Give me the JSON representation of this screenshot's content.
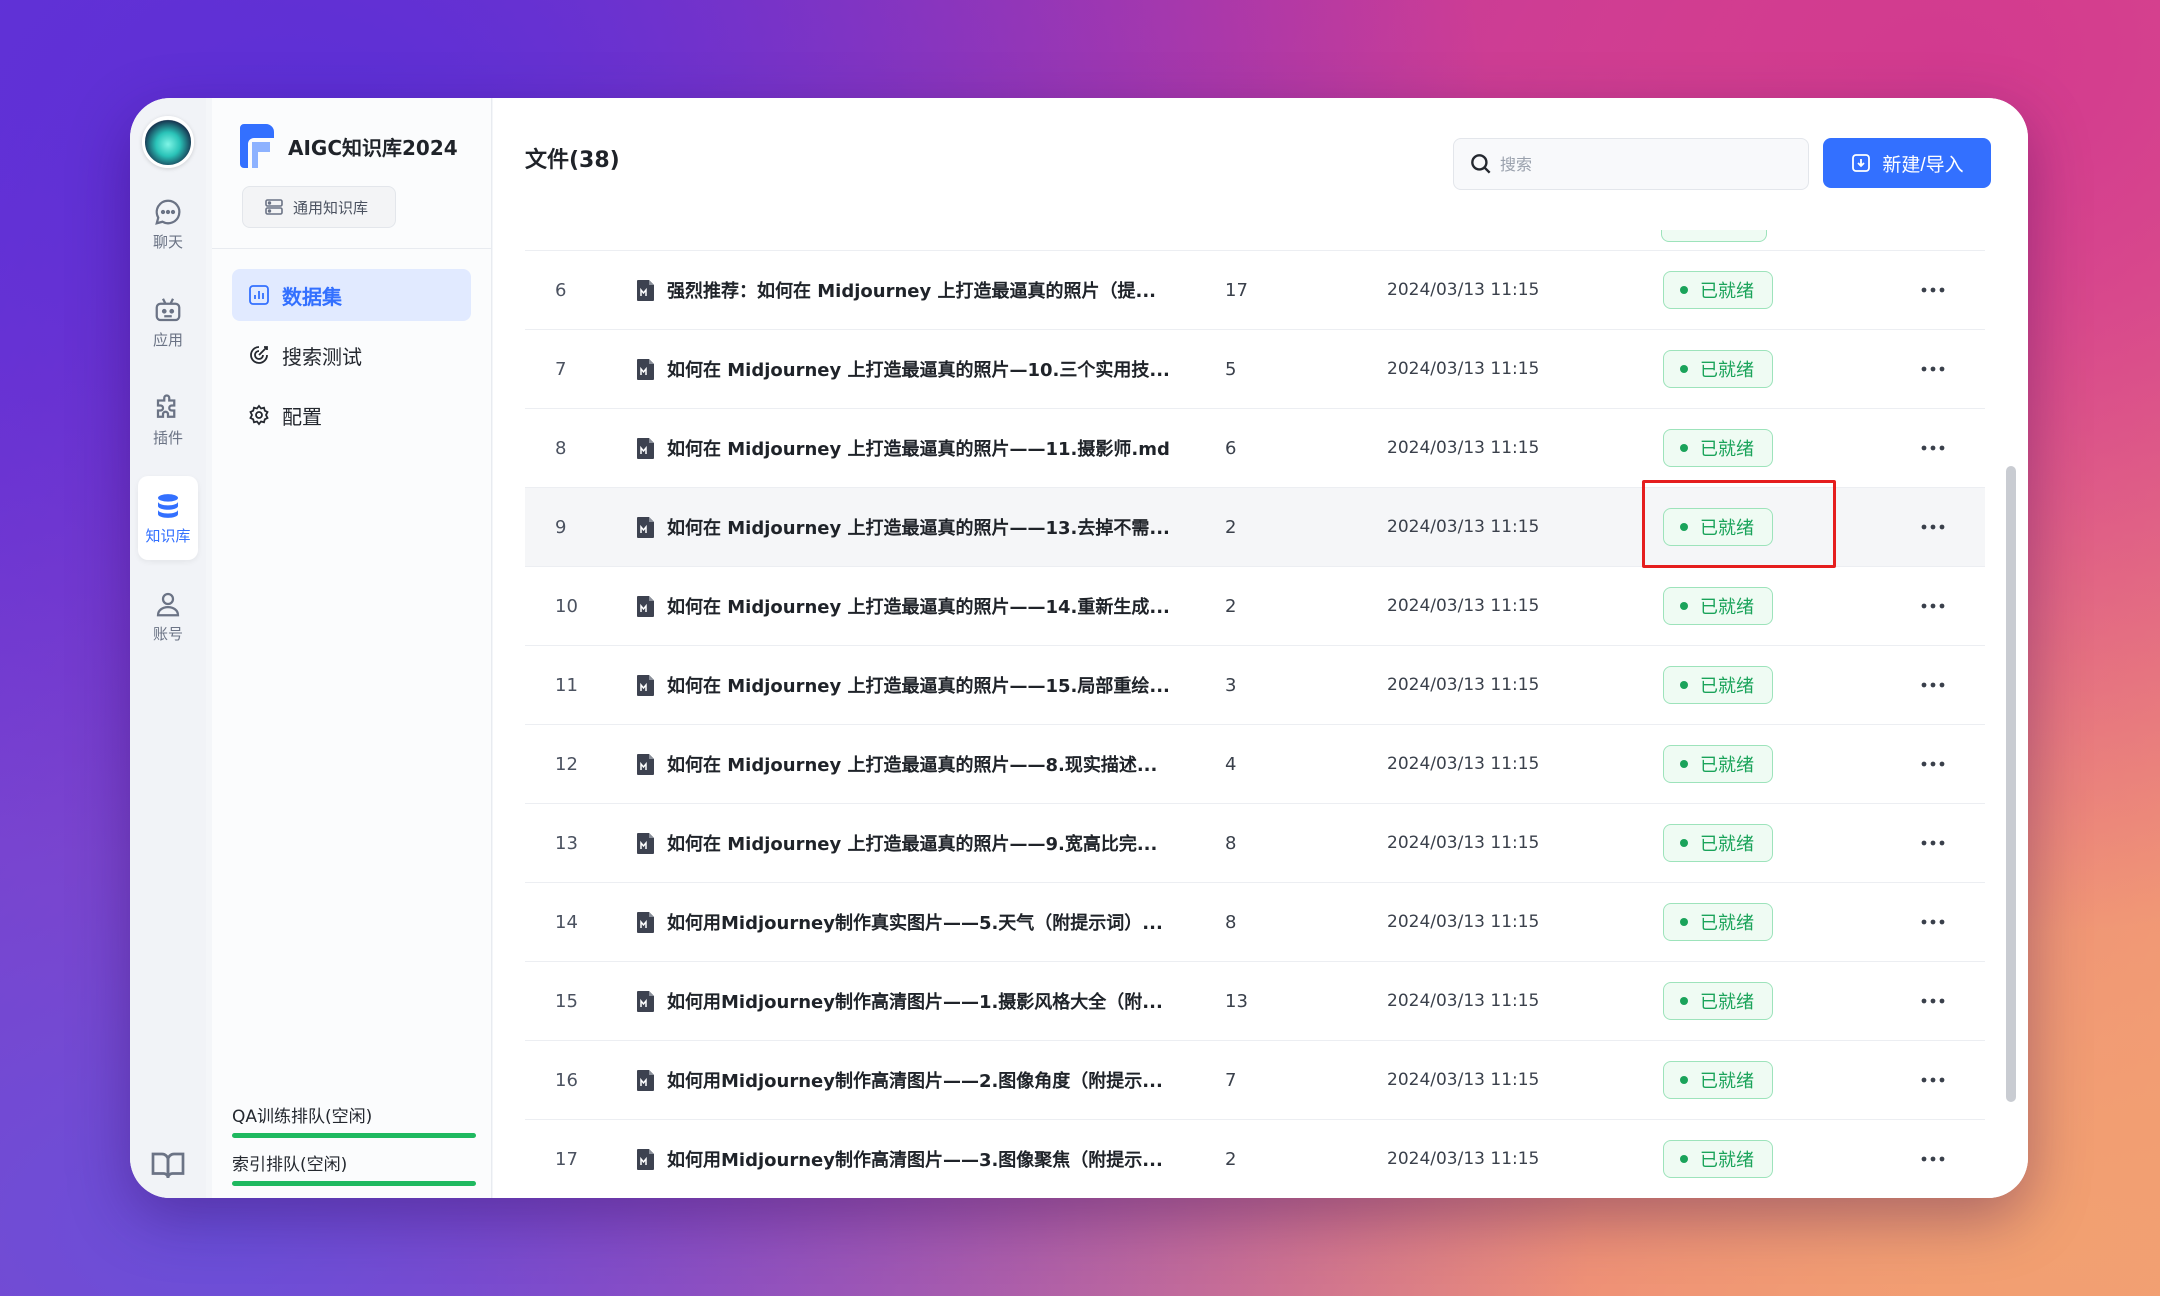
{
  "rail": {
    "items": [
      {
        "label": "聊天",
        "icon": "chat-icon"
      },
      {
        "label": "应用",
        "icon": "robot-icon"
      },
      {
        "label": "插件",
        "icon": "puzzle-icon"
      },
      {
        "label": "知识库",
        "icon": "database-icon",
        "active": true
      },
      {
        "label": "账号",
        "icon": "user-icon"
      }
    ]
  },
  "sidebar": {
    "kb_name": "AIGC知识库2024",
    "kb_type": "通用知识库",
    "nav": [
      {
        "label": "数据集",
        "active": true
      },
      {
        "label": "搜索测试"
      },
      {
        "label": "配置"
      }
    ],
    "queues": [
      {
        "label": "QA训练排队(空闲)"
      },
      {
        "label": "索引排队(空闲)"
      }
    ]
  },
  "main": {
    "title": "文件(38)",
    "search_placeholder": "搜索",
    "new_button": "新建/导入"
  },
  "files": [
    {
      "idx": "6",
      "name": "强烈推荐：如何在 Midjourney 上打造最逼真的照片（提...",
      "count": "17",
      "date": "2024/03/13 11:15",
      "status": "已就绪"
    },
    {
      "idx": "7",
      "name": "如何在 Midjourney 上打造最逼真的照片—10.三个实用技...",
      "count": "5",
      "date": "2024/03/13 11:15",
      "status": "已就绪"
    },
    {
      "idx": "8",
      "name": "如何在 Midjourney 上打造最逼真的照片——11.摄影师.md",
      "count": "6",
      "date": "2024/03/13 11:15",
      "status": "已就绪"
    },
    {
      "idx": "9",
      "name": "如何在 Midjourney 上打造最逼真的照片——13.去掉不需...",
      "count": "2",
      "date": "2024/03/13 11:15",
      "status": "已就绪"
    },
    {
      "idx": "10",
      "name": "如何在 Midjourney 上打造最逼真的照片——14.重新生成...",
      "count": "2",
      "date": "2024/03/13 11:15",
      "status": "已就绪"
    },
    {
      "idx": "11",
      "name": "如何在 Midjourney 上打造最逼真的照片——15.局部重绘...",
      "count": "3",
      "date": "2024/03/13 11:15",
      "status": "已就绪"
    },
    {
      "idx": "12",
      "name": "如何在 Midjourney 上打造最逼真的照片——8.现实描述...",
      "count": "4",
      "date": "2024/03/13 11:15",
      "status": "已就绪"
    },
    {
      "idx": "13",
      "name": "如何在 Midjourney 上打造最逼真的照片——9.宽高比完...",
      "count": "8",
      "date": "2024/03/13 11:15",
      "status": "已就绪"
    },
    {
      "idx": "14",
      "name": "如何用Midjourney制作真实图片——5.天气（附提示词）...",
      "count": "8",
      "date": "2024/03/13 11:15",
      "status": "已就绪"
    },
    {
      "idx": "15",
      "name": "如何用Midjourney制作高清图片——1.摄影风格大全（附...",
      "count": "13",
      "date": "2024/03/13 11:15",
      "status": "已就绪"
    },
    {
      "idx": "16",
      "name": "如何用Midjourney制作高清图片——2.图像角度（附提示...",
      "count": "7",
      "date": "2024/03/13 11:15",
      "status": "已就绪"
    },
    {
      "idx": "17",
      "name": "如何用Midjourney制作高清图片——3.图像聚焦（附提示...",
      "count": "2",
      "date": "2024/03/13 11:15",
      "status": "已就绪"
    }
  ],
  "colors": {
    "accent": "#3370ff",
    "ready": "#1aa35a",
    "highlight": "#e51e1e"
  }
}
